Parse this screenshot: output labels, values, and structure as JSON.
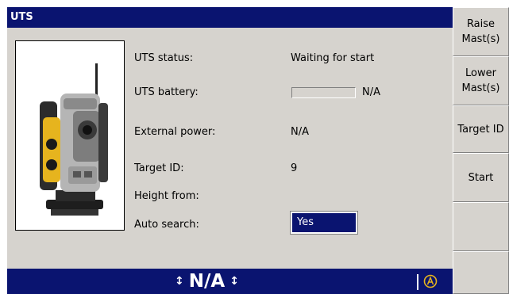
{
  "app": {
    "title": "UTS"
  },
  "fields": {
    "uts_status": {
      "label": "UTS status:",
      "value": "Waiting for start"
    },
    "uts_battery": {
      "label": "UTS battery:",
      "value": "N/A",
      "level": null
    },
    "external_power": {
      "label": "External power:",
      "value": "N/A"
    },
    "target_id": {
      "label": "Target ID:",
      "value": "9"
    },
    "height_from": {
      "label": "Height from:",
      "value": ""
    },
    "auto_search": {
      "label": "Auto search:",
      "value": "Yes"
    }
  },
  "statusbar": {
    "text": "N/A",
    "left_arrow": "↕",
    "right_arrow": "↕",
    "icon": "a-circle-icon"
  },
  "softkeys": [
    {
      "label": "Raise\nMast(s)"
    },
    {
      "label": "Lower\nMast(s)"
    },
    {
      "label": "Target ID"
    },
    {
      "label": "Start"
    },
    {
      "label": ""
    },
    {
      "label": ""
    }
  ],
  "colors": {
    "titlebar": "#0a1470",
    "background": "#d6d3ce",
    "device_yellow": "#e6b41e",
    "device_gray": "#9a9a9a"
  }
}
